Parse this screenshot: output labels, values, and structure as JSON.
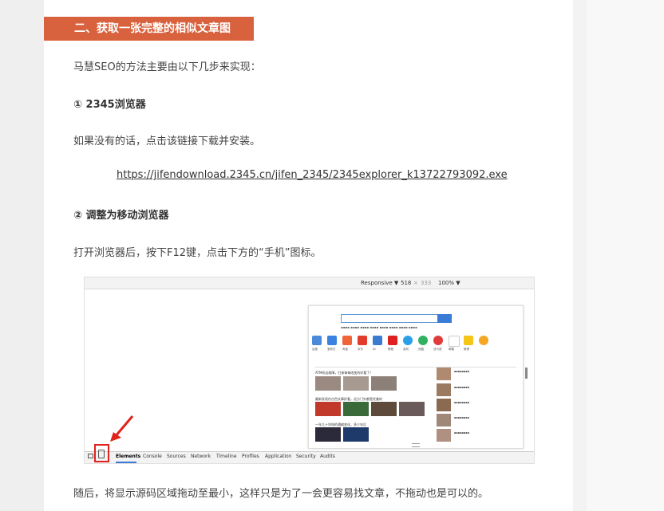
{
  "article": {
    "section_heading": "二、获取一张完整的相似文章图",
    "intro": "马慧SEO的方法主要由以下几步来实现：",
    "step1_title": "① 2345浏览器",
    "step1_text": "如果没有的话，点击该链接下载并安装。",
    "step1_link": "https://jifendownload.2345.cn/jifen_2345/2345explorer_k13722793092.exe",
    "step2_title": "② 调整为移动浏览器",
    "step2_text": "打开浏览器后，按下F12键，点击下方的“手机”图标。",
    "after_text": "随后，将显示源码区域拖动至最小，这样只是为了一会更容易找文章，不拖动也是可以的。"
  },
  "screenshot": {
    "device_mode": "Responsive ▼",
    "width": "518",
    "times": "×",
    "height": "333",
    "zoom": "100% ▼",
    "devtools_tabs": [
      "Elements",
      "Console",
      "Sources",
      "Network",
      "Timeline",
      "Profiles",
      "Application",
      "Security",
      "Audits"
    ],
    "news_headlines": [
      "ATM机出故障，归来每每改变的好看了！",
      "最新发现仿古色文章好看，远方门外都是优美的",
      "一年几十块钱的通缩变化，多少年后"
    ],
    "app_labels": [
      "百度",
      "爱奇艺",
      "淘宝",
      "京东",
      "JD",
      "携程",
      "游戏",
      "优酷",
      "亚马逊",
      "邮箱",
      "微博"
    ],
    "colors": {
      "heading_bg": "#d9623e",
      "highlight_red": "#e0221d",
      "link_blue": "#3a7bd5"
    }
  }
}
